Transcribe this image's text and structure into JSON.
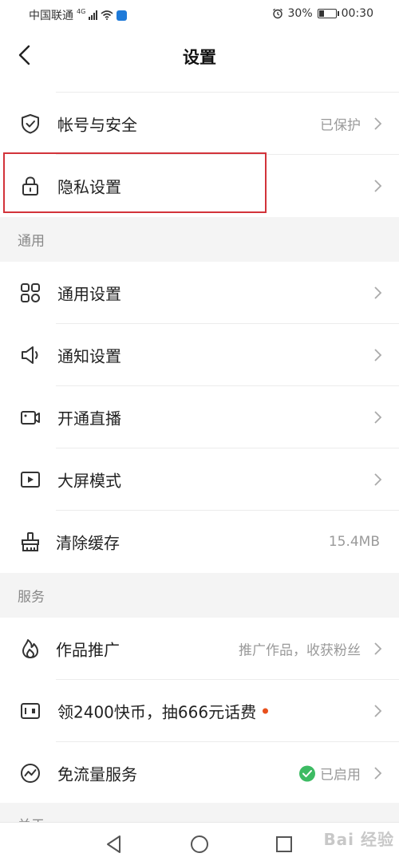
{
  "status_bar": {
    "carrier": "中国联通",
    "network": "4G",
    "battery": "30%",
    "battery_level": 0.3,
    "time": "00:30"
  },
  "header": {
    "title": "设置"
  },
  "rows": {
    "account": {
      "label": "帐号与安全",
      "value": "已保护"
    },
    "privacy": {
      "label": "隐私设置"
    }
  },
  "sections": {
    "general": {
      "title": "通用",
      "items": {
        "general_settings": {
          "label": "通用设置"
        },
        "notification_settings": {
          "label": "通知设置"
        },
        "live": {
          "label": "开通直播"
        },
        "bigscreen": {
          "label": "大屏模式"
        },
        "cache": {
          "label": "清除缓存",
          "value": "15.4MB"
        }
      }
    },
    "services": {
      "title": "服务",
      "items": {
        "promote": {
          "label": "作品推广",
          "value": "推广作品，收获粉丝"
        },
        "coins": {
          "label": "领2400快币，抽666元话费"
        },
        "freeflow": {
          "label": "免流量服务",
          "value": "已启用"
        }
      }
    },
    "next": {
      "title": "关于"
    }
  },
  "watermark": "Bai 经验",
  "colors": {
    "highlight": "#d2333a",
    "enabled": "#3dbb63",
    "dot": "#e8501c"
  },
  "icons": {
    "account": "shield-check-icon",
    "privacy": "lock-icon",
    "general": "grid-icon",
    "notification": "speaker-icon",
    "live": "video-camera-icon",
    "bigscreen": "play-icon",
    "cache": "broom-icon",
    "promote": "flame-icon",
    "coins": "coin-card-icon",
    "freeflow": "wave-circle-icon"
  }
}
